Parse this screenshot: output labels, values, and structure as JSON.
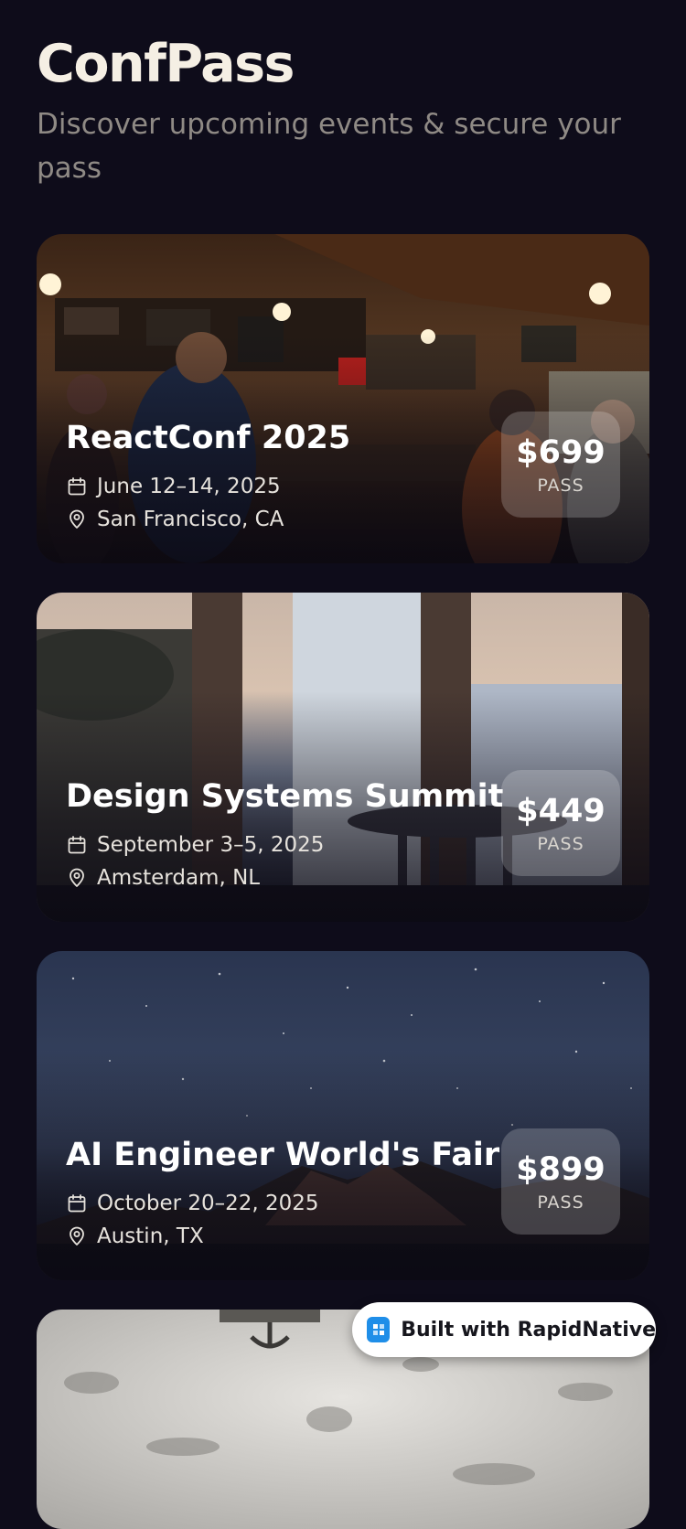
{
  "header": {
    "title": "ConfPass",
    "subtitle": "Discover upcoming events & secure your pass"
  },
  "events": [
    {
      "title": "ReactConf 2025",
      "date": "June 12–14, 2025",
      "location": "San Francisco, CA",
      "price": "$699",
      "price_label": "PASS"
    },
    {
      "title": "Design Systems Summit",
      "date": "September 3–5, 2025",
      "location": "Amsterdam, NL",
      "price": "$449",
      "price_label": "PASS"
    },
    {
      "title": "AI Engineer World's Fair",
      "date": "October 20–22, 2025",
      "location": "Austin, TX",
      "price": "$899",
      "price_label": "PASS"
    }
  ],
  "badge": {
    "label": "Built with RapidNative"
  },
  "icons": {
    "date": "calendar-icon",
    "location": "map-pin-icon",
    "badge": "rapidnative-logo-icon"
  },
  "colors": {
    "background": "#0e0c1a",
    "title": "#f5efe4",
    "subtitle": "#8f8a85",
    "badge_logo": "#1f8ee8"
  }
}
